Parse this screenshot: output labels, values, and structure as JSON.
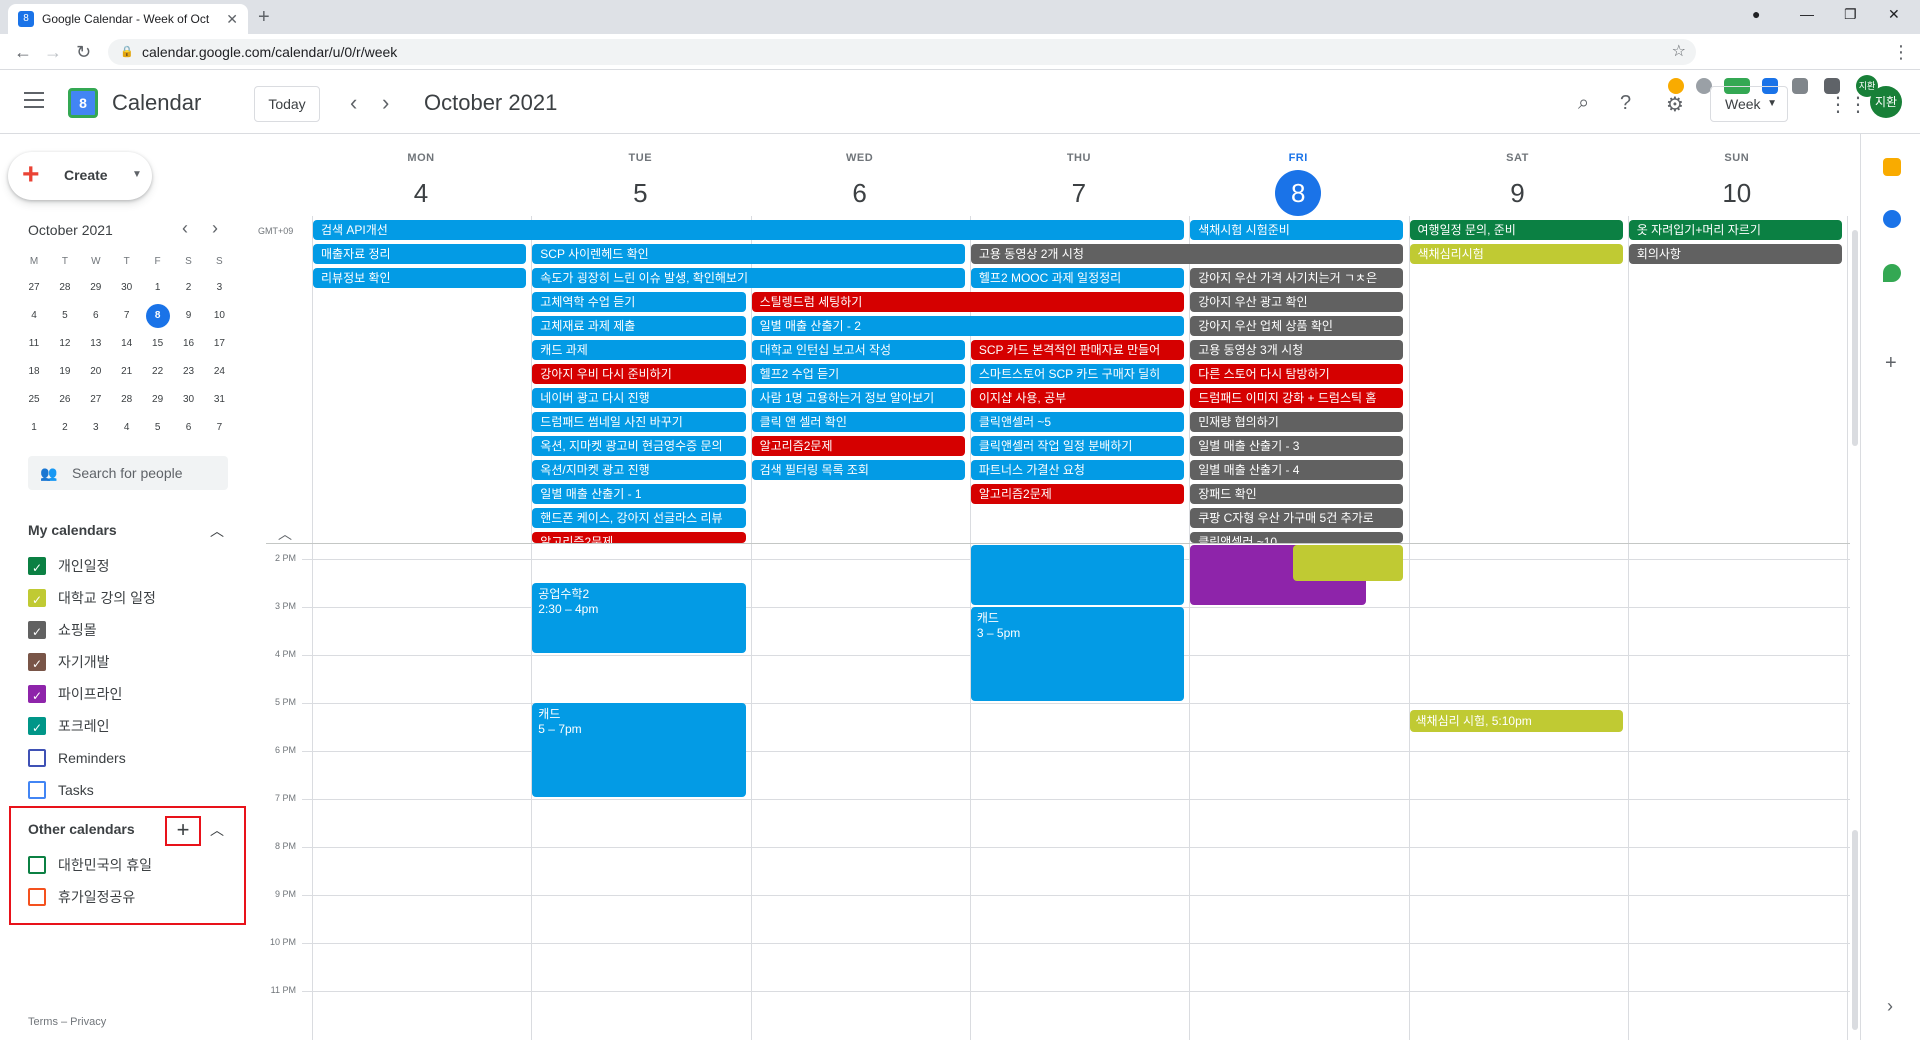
{
  "browser": {
    "tab_title": "Google Calendar - Week of Oct",
    "tab_favicon": "8",
    "url": "calendar.google.com/calendar/u/0/r/week",
    "profile_initials": "지환"
  },
  "header": {
    "app_title": "Calendar",
    "logo_day": "8",
    "today_label": "Today",
    "month_title": "October 2021",
    "view_label": "Week",
    "avatar_initials": "지환"
  },
  "sidebar": {
    "create_label": "Create",
    "mini_month": "October 2021",
    "weekday_headers": [
      "M",
      "T",
      "W",
      "T",
      "F",
      "S",
      "S"
    ],
    "mini_weeks": [
      [
        "27",
        "28",
        "29",
        "30",
        "1",
        "2",
        "3"
      ],
      [
        "4",
        "5",
        "6",
        "7",
        "8",
        "9",
        "10"
      ],
      [
        "11",
        "12",
        "13",
        "14",
        "15",
        "16",
        "17"
      ],
      [
        "18",
        "19",
        "20",
        "21",
        "22",
        "23",
        "24"
      ],
      [
        "25",
        "26",
        "27",
        "28",
        "29",
        "30",
        "31"
      ],
      [
        "1",
        "2",
        "3",
        "4",
        "5",
        "6",
        "7"
      ]
    ],
    "selected_day": "8",
    "search_people": "Search for people",
    "my_calendars_title": "My calendars",
    "my_calendars": [
      {
        "label": "개인일정",
        "color": "#0b8043",
        "checked": true
      },
      {
        "label": "대학교 강의 일정",
        "color": "#c0ca33",
        "checked": true
      },
      {
        "label": "쇼핑몰",
        "color": "#616161",
        "checked": true
      },
      {
        "label": "자기개발",
        "color": "#795548",
        "checked": true
      },
      {
        "label": "파이프라인",
        "color": "#8e24aa",
        "checked": true
      },
      {
        "label": "포크레인",
        "color": "#009688",
        "checked": true
      },
      {
        "label": "Reminders",
        "color": "#3f51b5",
        "checked": false
      },
      {
        "label": "Tasks",
        "color": "#4285f4",
        "checked": false
      }
    ],
    "other_calendars_title": "Other calendars",
    "other_calendars": [
      {
        "label": "대한민국의 휴일",
        "color": "#0b8043",
        "checked": false
      },
      {
        "label": "휴가일정공유",
        "color": "#f4511e",
        "checked": false
      }
    ],
    "footer": "Terms – Privacy"
  },
  "week": {
    "timezone": "GMT+09",
    "days": [
      {
        "dow": "MON",
        "date": "4",
        "today": false
      },
      {
        "dow": "TUE",
        "date": "5",
        "today": false
      },
      {
        "dow": "WED",
        "date": "6",
        "today": false
      },
      {
        "dow": "THU",
        "date": "7",
        "today": false
      },
      {
        "dow": "FRI",
        "date": "8",
        "today": true
      },
      {
        "dow": "SAT",
        "date": "9",
        "today": false
      },
      {
        "dow": "SUN",
        "date": "10",
        "today": false
      }
    ],
    "time_labels": [
      "2 PM",
      "3 PM",
      "4 PM",
      "5 PM",
      "6 PM",
      "7 PM",
      "8 PM",
      "9 PM",
      "10 PM",
      "11 PM"
    ]
  },
  "colors": {
    "blue": "#039be5",
    "gray": "#616161",
    "red": "#d50000",
    "green": "#0b8043",
    "olive": "#c0ca33",
    "purple": "#8e24aa",
    "today_blue": "#1a73e8"
  },
  "allday_events": [
    {
      "day": 0,
      "span": 4,
      "row": 0,
      "title": "검색 API개선",
      "color": "blue"
    },
    {
      "day": 4,
      "span": 1,
      "row": 0,
      "title": "색채시험 시험준비",
      "color": "blue"
    },
    {
      "day": 5,
      "span": 1,
      "row": 0,
      "title": "여행일정 문의, 준비",
      "color": "green"
    },
    {
      "day": 6,
      "span": 1,
      "row": 0,
      "title": "옷 자려입기+머리 자르기",
      "color": "green"
    },
    {
      "day": 0,
      "span": 1,
      "row": 1,
      "title": "매출자료 정리",
      "color": "blue"
    },
    {
      "day": 1,
      "span": 2,
      "row": 1,
      "title": "SCP 사이렌헤드 확인",
      "color": "blue"
    },
    {
      "day": 3,
      "span": 2,
      "row": 1,
      "title": "고용 동영상 2개 시청",
      "color": "gray"
    },
    {
      "day": 5,
      "span": 1,
      "row": 1,
      "title": "색채심리시험",
      "color": "olive"
    },
    {
      "day": 6,
      "span": 1,
      "row": 1,
      "title": "회의사항",
      "color": "gray"
    },
    {
      "day": 0,
      "span": 1,
      "row": 2,
      "title": "리뷰정보 확인",
      "color": "blue"
    },
    {
      "day": 1,
      "span": 2,
      "row": 2,
      "title": "속도가 굉장히 느린 이슈 발생, 확인해보기",
      "color": "blue"
    },
    {
      "day": 3,
      "span": 1,
      "row": 2,
      "title": "헬프2 MOOC 과제 일정정리",
      "color": "blue"
    },
    {
      "day": 4,
      "span": 1,
      "row": 2,
      "title": "강아지 우산 가격 사기치는거 ㄱㅊ은",
      "color": "gray"
    },
    {
      "day": 1,
      "span": 1,
      "row": 3,
      "title": "고체역학 수업 듣기",
      "color": "blue"
    },
    {
      "day": 2,
      "span": 2,
      "row": 3,
      "title": "스틸렝드럼 세팅하기",
      "color": "red"
    },
    {
      "day": 4,
      "span": 1,
      "row": 3,
      "title": "강아지 우산 광고 확인",
      "color": "gray"
    },
    {
      "day": 1,
      "span": 1,
      "row": 4,
      "title": "고체재료 과제 제출",
      "color": "blue"
    },
    {
      "day": 2,
      "span": 2,
      "row": 4,
      "title": "일별 매출 산출기 - 2",
      "color": "blue"
    },
    {
      "day": 4,
      "span": 1,
      "row": 4,
      "title": "강아지 우산 업체 상품 확인",
      "color": "gray"
    },
    {
      "day": 1,
      "span": 1,
      "row": 5,
      "title": "캐드 과제",
      "color": "blue"
    },
    {
      "day": 2,
      "span": 1,
      "row": 5,
      "title": "대학교 인턴십 보고서 작성",
      "color": "blue"
    },
    {
      "day": 3,
      "span": 1,
      "row": 5,
      "title": "SCP 카드 본격적인 판매자료 만들어",
      "color": "red"
    },
    {
      "day": 4,
      "span": 1,
      "row": 5,
      "title": "고용 동영상 3개 시청",
      "color": "gray"
    },
    {
      "day": 1,
      "span": 1,
      "row": 6,
      "title": "강아지 우비 다시 준비하기",
      "color": "red"
    },
    {
      "day": 2,
      "span": 1,
      "row": 6,
      "title": "헬프2 수업 듣기",
      "color": "blue"
    },
    {
      "day": 3,
      "span": 1,
      "row": 6,
      "title": "스마트스토어 SCP 카드 구매자 딜히",
      "color": "blue"
    },
    {
      "day": 4,
      "span": 1,
      "row": 6,
      "title": "다른 스토어 다시 탐방하기",
      "color": "red"
    },
    {
      "day": 1,
      "span": 1,
      "row": 7,
      "title": "네이버 광고 다시 진행",
      "color": "blue"
    },
    {
      "day": 2,
      "span": 1,
      "row": 7,
      "title": "사람 1명 고용하는거 정보 알아보기",
      "color": "blue"
    },
    {
      "day": 3,
      "span": 1,
      "row": 7,
      "title": "이지샵 사용, 공부",
      "color": "red"
    },
    {
      "day": 4,
      "span": 1,
      "row": 7,
      "title": "드럼패드 이미지 강화 + 드럼스틱 홈",
      "color": "red"
    },
    {
      "day": 1,
      "span": 1,
      "row": 8,
      "title": "드럼패드 썸네일 사진 바꾸기",
      "color": "blue"
    },
    {
      "day": 2,
      "span": 1,
      "row": 8,
      "title": "클릭 앤 셀러 확인",
      "color": "blue"
    },
    {
      "day": 3,
      "span": 1,
      "row": 8,
      "title": "클릭앤셀러 ~5",
      "color": "blue"
    },
    {
      "day": 4,
      "span": 1,
      "row": 8,
      "title": "민재량 협의하기",
      "color": "gray"
    },
    {
      "day": 1,
      "span": 1,
      "row": 9,
      "title": "옥션, 지마켓 광고비 현금영수증 문의",
      "color": "blue"
    },
    {
      "day": 2,
      "span": 1,
      "row": 9,
      "title": "알고리즘2문제",
      "color": "red"
    },
    {
      "day": 3,
      "span": 1,
      "row": 9,
      "title": "클릭앤셀러 작업 일정 분배하기",
      "color": "blue"
    },
    {
      "day": 4,
      "span": 1,
      "row": 9,
      "title": "일별 매출 산출기 - 3",
      "color": "gray"
    },
    {
      "day": 1,
      "span": 1,
      "row": 10,
      "title": "옥션/지마켓 광고 진행",
      "color": "blue"
    },
    {
      "day": 2,
      "span": 1,
      "row": 10,
      "title": "검색 필터링 목록 조회",
      "color": "blue"
    },
    {
      "day": 3,
      "span": 1,
      "row": 10,
      "title": "파트너스 가결산 요청",
      "color": "blue"
    },
    {
      "day": 4,
      "span": 1,
      "row": 10,
      "title": "일별 매출 산출기 - 4",
      "color": "gray"
    },
    {
      "day": 1,
      "span": 1,
      "row": 11,
      "title": "일별 매출 산출기 - 1",
      "color": "blue"
    },
    {
      "day": 3,
      "span": 1,
      "row": 11,
      "title": "알고리즘2문제",
      "color": "red"
    },
    {
      "day": 4,
      "span": 1,
      "row": 11,
      "title": "장패드 확인",
      "color": "gray"
    },
    {
      "day": 1,
      "span": 1,
      "row": 12,
      "title": "핸드폰 케이스, 강아지 선글라스 리뷰",
      "color": "blue"
    },
    {
      "day": 4,
      "span": 1,
      "row": 12,
      "title": "쿠팡 C자형 우산 가구매 5건 추가로",
      "color": "gray"
    },
    {
      "day": 1,
      "span": 1,
      "row": 13,
      "title": "알고리즘2문제",
      "color": "red"
    },
    {
      "day": 4,
      "span": 1,
      "row": 13,
      "title": "클릭앤셀러 ~10",
      "color": "gray"
    }
  ],
  "timed_events": [
    {
      "day": 1,
      "start": 14.5,
      "end": 16,
      "title": "공업수학2",
      "time": "2:30 – 4pm",
      "color": "blue"
    },
    {
      "day": 1,
      "start": 17,
      "end": 19,
      "title": "캐드",
      "time": "5 – 7pm",
      "color": "blue"
    },
    {
      "day": 3,
      "start": 13.5,
      "end": 15,
      "title": "",
      "time": "",
      "color": "blue"
    },
    {
      "day": 3,
      "start": 15,
      "end": 17,
      "title": "캐드",
      "time": "3 – 5pm",
      "color": "blue"
    },
    {
      "day": 4,
      "start": 13.5,
      "end": 15,
      "title": "",
      "time": "",
      "color": "purple"
    },
    {
      "day": 4.47,
      "start": 13.5,
      "end": 14.5,
      "title": "",
      "time": "",
      "color": "olive"
    },
    {
      "day": 5,
      "start": 17.15,
      "end": 17.65,
      "title": "색채심리 시험, 5:10pm",
      "time": "",
      "color": "olive"
    }
  ]
}
